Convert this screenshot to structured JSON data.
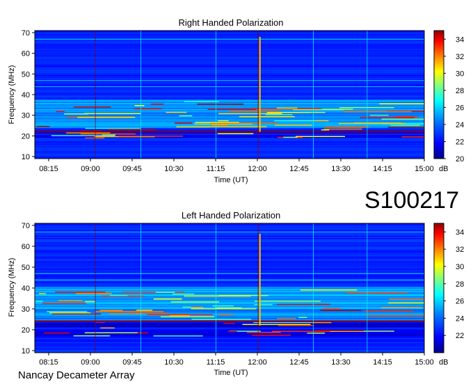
{
  "figure_id": "S100217",
  "footer": "Nancay Decameter Array",
  "chart_data": [
    {
      "type": "heatmap",
      "title": "Right Handed Polarization",
      "xlabel": "Time (UT)",
      "ylabel": "Frequency (MHz)",
      "x_tick_labels": [
        "08:15",
        "09:00",
        "09:45",
        "10:30",
        "11:15",
        "12:00",
        "12:45",
        "13:30",
        "14:15",
        "15:00"
      ],
      "x_range": [
        "08:00",
        "15:00"
      ],
      "y_ticks": [
        10,
        20,
        30,
        40,
        50,
        60,
        70
      ],
      "ylim": [
        9,
        71
      ],
      "colorbar": {
        "label": "dB",
        "ticks": [
          20,
          22,
          24,
          26,
          28,
          30,
          32,
          34
        ],
        "range": [
          20,
          35
        ]
      },
      "colormap": [
        "#00008b",
        "#0000ff",
        "#0080ff",
        "#00ffff",
        "#80ff80",
        "#ffff00",
        "#ff8000",
        "#ff0000",
        "#8b0000"
      ],
      "features": {
        "background_db": 22.5,
        "noisy_band_mhz": [
          24,
          37
        ],
        "saturated_band_mhz": [
          19,
          22
        ],
        "vertical_burst_time": "12:02",
        "vertical_burst_mhz": [
          22,
          68
        ]
      }
    },
    {
      "type": "heatmap",
      "title": "Left Handed Polarization",
      "xlabel": "Time (UT)",
      "ylabel": "Frequency (MHz)",
      "x_tick_labels": [
        "08:15",
        "09:00",
        "09:45",
        "10:30",
        "11:15",
        "12:00",
        "12:45",
        "13:30",
        "14:15",
        "15:00"
      ],
      "x_range": [
        "08:00",
        "15:00"
      ],
      "y_ticks": [
        10,
        20,
        30,
        40,
        50,
        60,
        70
      ],
      "ylim": [
        9,
        71
      ],
      "colorbar": {
        "label": "dB",
        "ticks": [
          22,
          24,
          26,
          28,
          30,
          32,
          34
        ],
        "range": [
          20,
          35
        ]
      },
      "colormap": [
        "#00008b",
        "#0000ff",
        "#0080ff",
        "#00ffff",
        "#80ff80",
        "#ffff00",
        "#ff8000",
        "#ff0000",
        "#8b0000"
      ],
      "features": {
        "background_db": 22.5,
        "noisy_band_mhz": [
          24,
          40
        ],
        "saturated_band_mhz": [
          17,
          24
        ],
        "vertical_burst_time": "12:02",
        "vertical_burst_mhz": [
          22,
          66
        ]
      }
    }
  ]
}
